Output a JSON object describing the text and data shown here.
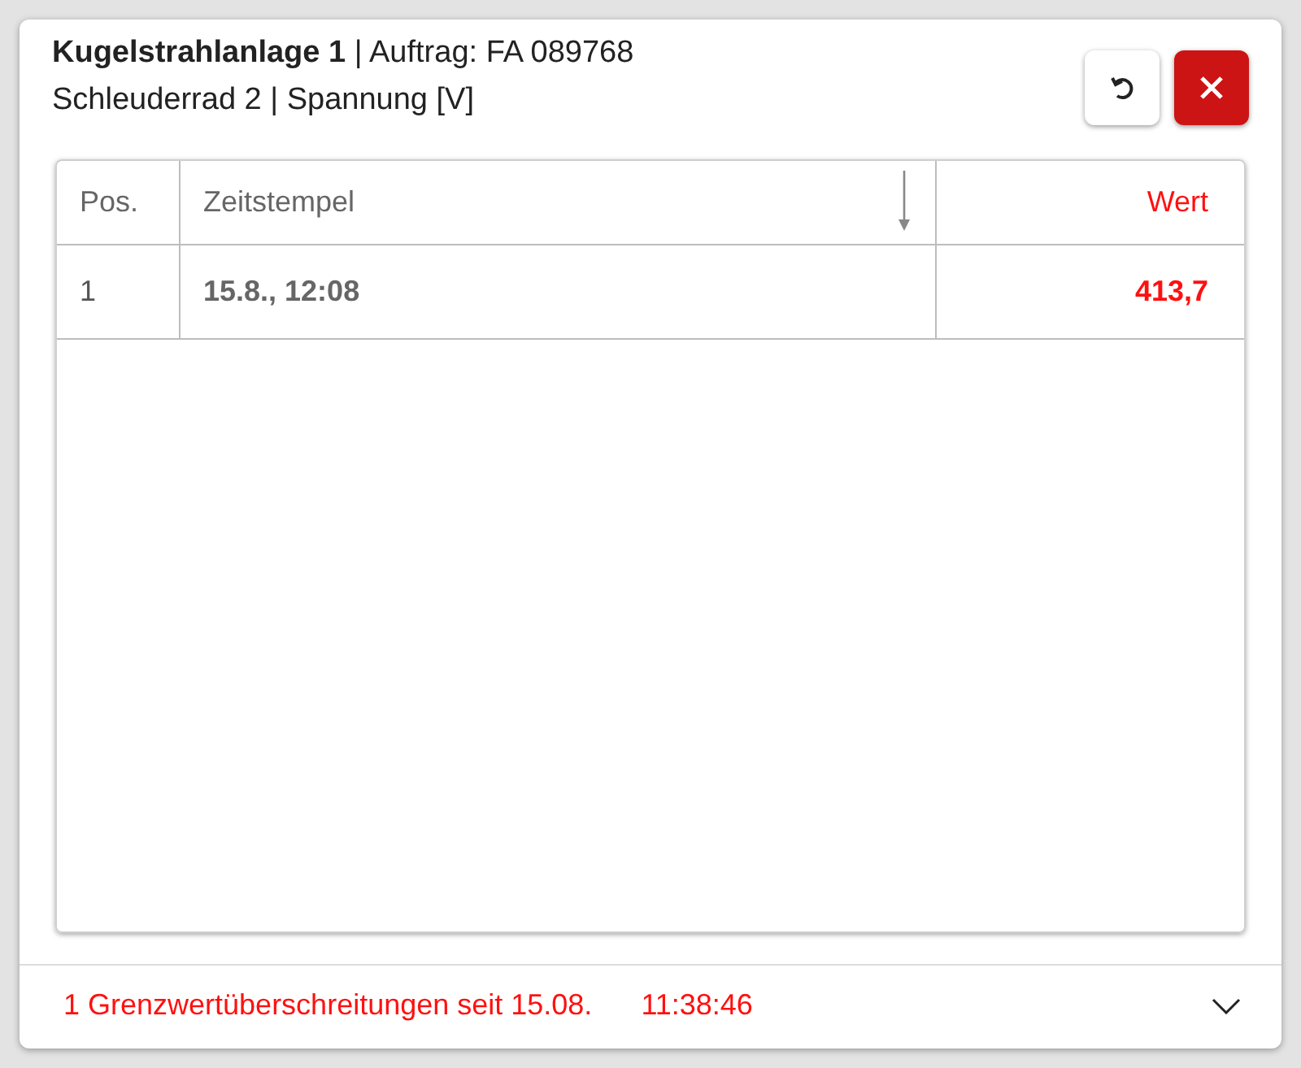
{
  "header": {
    "title": "**Kugelstrahlanlage 1** | Auftrag: FA 089768",
    "subtitle": "Schleuderrad 2 | Spannung [V]"
  },
  "table": {
    "columns": [
      {
        "label": "Pos.",
        "kind": "text",
        "sorted": false,
        "highlight": false
      },
      {
        "label": "Zeitstempel",
        "kind": "text",
        "sorted": true,
        "highlight": false
      },
      {
        "label": "Wert",
        "kind": "number",
        "sorted": false,
        "highlight": true
      }
    ],
    "rows": [
      [
        "1",
        "15.8., 12:08",
        "413,7"
      ]
    ]
  },
  "footer": {
    "message": "1 Grenzwertüberschreitungen seit 15.08.",
    "time": "11:38:46",
    "expanded": false
  }
}
